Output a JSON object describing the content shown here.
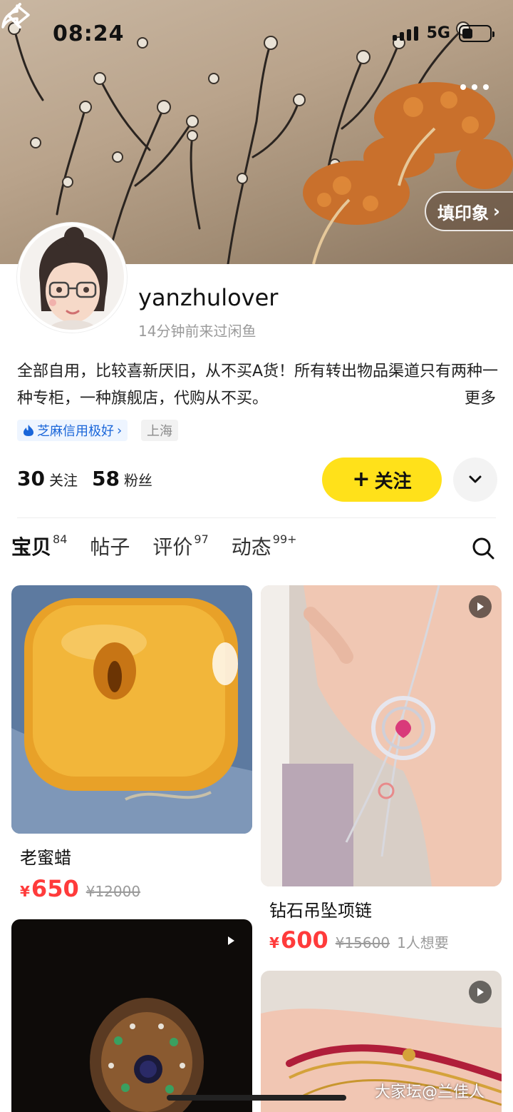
{
  "status_bar": {
    "time": "08:24",
    "network": "5G",
    "battery_level": 0.4
  },
  "header": {
    "stamp_button_label": "填印象",
    "nav_icons": [
      "back-icon",
      "share-icon",
      "more-icon"
    ]
  },
  "profile": {
    "username": "yanzhulover",
    "last_seen": "14分钟前来过闲鱼",
    "bio": "全部自用，比较喜新厌旧，从不买A货！所有转出物品渠道只有两种一种专柜，一种旗舰店，代购从不买。",
    "bio_more": "更多",
    "credit_tag": "芝麻信用极好",
    "location_tag": "上海",
    "following_count": "30",
    "following_label": "关注",
    "followers_count": "58",
    "followers_label": "粉丝",
    "follow_button_label": "关注"
  },
  "tabs": [
    {
      "label": "宝贝",
      "count": "84",
      "active": true
    },
    {
      "label": "帖子",
      "count": "",
      "active": false
    },
    {
      "label": "评价",
      "count": "97",
      "active": false
    },
    {
      "label": "动态",
      "count": "99+",
      "active": false
    }
  ],
  "products": [
    {
      "title": "老蜜蜡",
      "price_symbol": "¥",
      "price": "650",
      "original_price": "¥12000",
      "want": "",
      "has_video": false
    },
    {
      "title": "钻石吊坠项链",
      "price_symbol": "¥",
      "price": "600",
      "original_price": "¥15600",
      "want": "1人想要",
      "has_video": true
    },
    {
      "title": "",
      "price_symbol": "",
      "price": "",
      "original_price": "",
      "want": "",
      "has_video": true
    },
    {
      "title": "",
      "price_symbol": "",
      "price": "",
      "original_price": "",
      "want": "",
      "has_video": true
    }
  ],
  "watermark": "大家坛@兰佳人",
  "colors": {
    "accent_yellow": "#ffe11a",
    "price_red": "#ff3b3b",
    "credit_blue": "#1a66d9"
  }
}
